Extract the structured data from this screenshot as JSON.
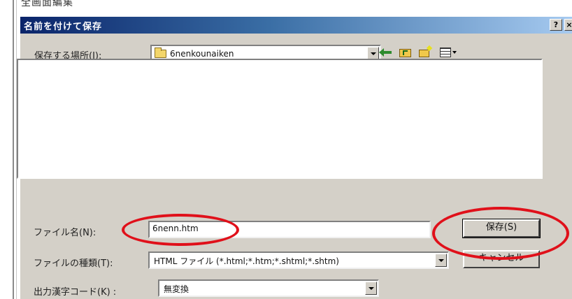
{
  "parent_window": {
    "title": "全画面編集"
  },
  "dialog": {
    "title": "名前を付けて保存",
    "help_label": "?",
    "close_label": "×"
  },
  "location": {
    "label": "保存する場所(I):",
    "value": "6nenkounaiken",
    "icon": "folder-icon"
  },
  "toolbar": {
    "icons": [
      "back-arrow-icon",
      "up-folder-icon",
      "new-folder-icon",
      "view-menu-icon"
    ]
  },
  "filename": {
    "label": "ファイル名(N):",
    "value": "6nenn.htm"
  },
  "filetype": {
    "label": "ファイルの種類(T):",
    "value": "HTML ファイル (*.html;*.htm;*.shtml;*.shtm)"
  },
  "encoding": {
    "label": "出力漢字コード(K) :",
    "value": "無変換"
  },
  "buttons": {
    "save": "保存(S)",
    "cancel": "キャンセル"
  },
  "annotations": {
    "color": "#e0101a",
    "highlighted": [
      "filename-field",
      "save-button"
    ]
  }
}
